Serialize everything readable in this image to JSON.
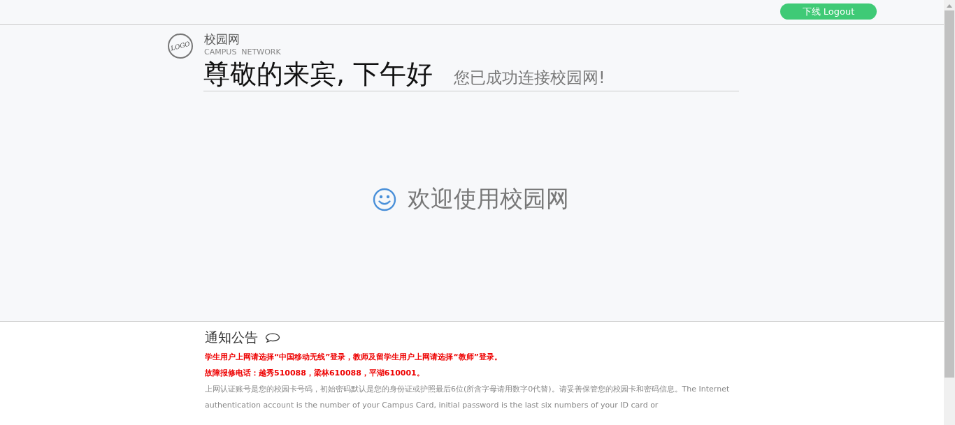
{
  "header": {
    "logout_button": "下线 Logout"
  },
  "brand": {
    "logo": "LOGO",
    "name": "校园网",
    "subtitle": "CAMPUS  NETWORK"
  },
  "greeting": {
    "title": "尊敬的来宾, 下午好",
    "message": "您已成功连接校园网!"
  },
  "welcome": {
    "text": "欢迎使用校园网"
  },
  "notice": {
    "title": "通知公告",
    "lines": [
      {
        "kind": "alert",
        "text": "学生用户上网请选择“中国移动无线”登录，教师及留学生用户上网请选择“教师”登录。"
      },
      {
        "kind": "alert",
        "text": "故障报修电话：越秀510088，梁林610088，平湖610001。"
      },
      {
        "kind": "info",
        "text": "上网认证账号是您的校园卡号码，初始密码默认是您的身份证或护照最后6位(所含字母请用数字0代替)。请妥善保管您的校园卡和密码信息。The Internet authentication account is the number of your Campus Card, initial password is the last six numbers of your ID card or"
      }
    ]
  }
}
